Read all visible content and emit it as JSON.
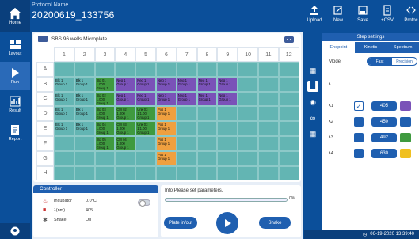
{
  "nav": {
    "home": "Home",
    "items": [
      {
        "label": "Layout",
        "icon": "layout-icon"
      },
      {
        "label": "Run",
        "icon": "run-icon"
      },
      {
        "label": "Result",
        "icon": "result-icon"
      },
      {
        "label": "Report",
        "icon": "report-icon"
      }
    ]
  },
  "protocol": {
    "label": "Protocol Name",
    "value": "20200619_133756"
  },
  "toolbar": [
    {
      "label": "Upload",
      "icon": "upload-icon"
    },
    {
      "label": "New",
      "icon": "new-icon"
    },
    {
      "label": "Save",
      "icon": "save-icon"
    },
    {
      "label": "+CSV",
      "icon": "csv-icon"
    },
    {
      "label": "Protoc",
      "icon": "protocol-icon"
    }
  ],
  "plate": {
    "name": "SBS 96 wells Microplate",
    "columns": [
      "1",
      "2",
      "3",
      "4",
      "5",
      "6",
      "7",
      "8",
      "9",
      "10",
      "11",
      "12"
    ],
    "rows": [
      "A",
      "B",
      "C",
      "D",
      "E",
      "F",
      "G",
      "H"
    ]
  },
  "wells": [
    {
      "r": 1,
      "c": 0,
      "text": "Blk 1\nGroup 1",
      "color": "#63b5b3"
    },
    {
      "r": 1,
      "c": 1,
      "text": "Blk 1\nGroup 1",
      "color": "#63b5b3"
    },
    {
      "r": 1,
      "c": 2,
      "text": "Std 01\n1.000\nGroup 1",
      "color": "#3f9a3f"
    },
    {
      "r": 1,
      "c": 3,
      "text": "Neg 1\nGroup 1",
      "color": "#7a52b8"
    },
    {
      "r": 1,
      "c": 4,
      "text": "Neg 1\nGroup 1",
      "color": "#7a52b8"
    },
    {
      "r": 1,
      "c": 5,
      "text": "Neg 1\nGroup 1",
      "color": "#7a52b8"
    },
    {
      "r": 1,
      "c": 6,
      "text": "Neg 1\nGroup 1",
      "color": "#7a52b8"
    },
    {
      "r": 1,
      "c": 7,
      "text": "Neg 1\nGroup 1",
      "color": "#7a52b8"
    },
    {
      "r": 1,
      "c": 8,
      "text": "Neg 1\nGroup 1",
      "color": "#7a52b8"
    },
    {
      "r": 2,
      "c": 0,
      "text": "Blk 1\nGroup 1",
      "color": "#63b5b3"
    },
    {
      "r": 2,
      "c": 1,
      "text": "Blk 1\nGroup 1",
      "color": "#63b5b3"
    },
    {
      "r": 2,
      "c": 2,
      "text": "Std 02\n1.000\nGroup 1",
      "color": "#3f9a3f"
    },
    {
      "r": 2,
      "c": 3,
      "text": "Neg 1\nGroup 1",
      "color": "#7a52b8"
    },
    {
      "r": 2,
      "c": 4,
      "text": "Neg 1\nGroup 1",
      "color": "#7a52b8"
    },
    {
      "r": 2,
      "c": 5,
      "text": "Neg 1\nGroup 1",
      "color": "#7a52b8"
    },
    {
      "r": 2,
      "c": 6,
      "text": "Neg 1\nGroup 1",
      "color": "#7a52b8"
    },
    {
      "r": 2,
      "c": 7,
      "text": "Neg 1\nGroup 1",
      "color": "#7a52b8"
    },
    {
      "r": 2,
      "c": 8,
      "text": "Neg 1\nGroup 1",
      "color": "#7a52b8"
    },
    {
      "r": 3,
      "c": 0,
      "text": "Blk 1\nGroup 1",
      "color": "#63b5b3"
    },
    {
      "r": 3,
      "c": 1,
      "text": "Blk 1\nGroup 1",
      "color": "#63b5b3"
    },
    {
      "r": 3,
      "c": 2,
      "text": "Std 03\n1.000\nGroup 1",
      "color": "#3f9a3f"
    },
    {
      "r": 3,
      "c": 3,
      "text": "Ctrl 02\n1.000\nGroup 1",
      "color": "#3f9a3f"
    },
    {
      "r": 3,
      "c": 4,
      "text": "Unk 03\n1:1.00\nGroup 1",
      "color": "#3f9a3f"
    },
    {
      "r": 3,
      "c": 5,
      "text": "Pos 1\nGroup 1",
      "color": "#f0a040"
    },
    {
      "r": 4,
      "c": 0,
      "text": "Blk 1\nGroup 1",
      "color": "#63b5b3"
    },
    {
      "r": 4,
      "c": 1,
      "text": "Blk 1\nGroup 1",
      "color": "#63b5b3"
    },
    {
      "r": 4,
      "c": 2,
      "text": "Std 04\n1.000\nGroup 1",
      "color": "#3f9a3f"
    },
    {
      "r": 4,
      "c": 3,
      "text": "Ctrl 03\n1.000\nGroup 1",
      "color": "#3f9a3f"
    },
    {
      "r": 4,
      "c": 4,
      "text": "Unk 03\n1:1.00\nGroup 1",
      "color": "#3f9a3f"
    },
    {
      "r": 4,
      "c": 5,
      "text": "Pos 1\nGroup 1",
      "color": "#f0a040"
    },
    {
      "r": 5,
      "c": 2,
      "text": "Std 05\n1.000\nGroup 1",
      "color": "#3f9a3f"
    },
    {
      "r": 5,
      "c": 3,
      "text": "Ctrl 04\n1.000\nGroup 1",
      "color": "#3f9a3f"
    },
    {
      "r": 5,
      "c": 5,
      "text": "Pos 1\nGroup 1",
      "color": "#f0a040"
    },
    {
      "r": 6,
      "c": 5,
      "text": "Pos 1\nGroup 1",
      "color": "#f0a040"
    }
  ],
  "controller": {
    "title": "Controller",
    "rows": [
      {
        "name": "Incubator",
        "value": "0.0°C",
        "icon": "thermometer-icon"
      },
      {
        "name": "λ(nm)",
        "value": "405",
        "icon": "wavelength-icon"
      },
      {
        "name": "Shake",
        "value": "On",
        "icon": "shake-icon"
      }
    ]
  },
  "info": {
    "text": "Info:Please set parameters.",
    "progress_pct": "0%",
    "plate_btn": "Plate in/out",
    "shake_btn": "Shake"
  },
  "steps": {
    "title": "Step settings",
    "tabs": [
      "Endpoint",
      "Kinetic",
      "Spectrum"
    ],
    "mode_label": "Mode",
    "mode_options": [
      "Fast",
      "Precision"
    ],
    "lambda_head": "λ",
    "lambdas": [
      {
        "label": "λ1",
        "value": "405",
        "checked": true,
        "color": "#7a52b8"
      },
      {
        "label": "λ2",
        "value": "450",
        "checked": false,
        "color": "#1f5fb0"
      },
      {
        "label": "λ3",
        "value": "492",
        "checked": false,
        "color": "#3f9a3f"
      },
      {
        "label": "λ4",
        "value": "630",
        "checked": false,
        "color": "#f0c020"
      }
    ]
  },
  "status": {
    "datetime": "06-19-2020 13:39:40"
  }
}
